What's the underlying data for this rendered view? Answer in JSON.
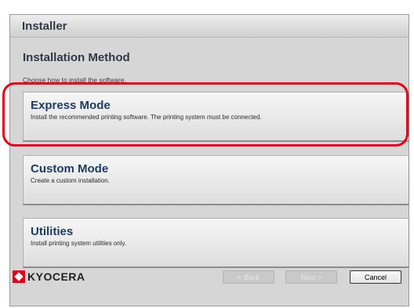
{
  "window": {
    "title": "Installer"
  },
  "page": {
    "heading": "Installation Method",
    "subtitle": "Choose how to install the software."
  },
  "options": [
    {
      "title": "Express Mode",
      "description": "Install the recommended printing software. The printing system must be connected."
    },
    {
      "title": "Custom Mode",
      "description": "Create a custom installation."
    },
    {
      "title": "Utilities",
      "description": "Install printing system utilities only."
    }
  ],
  "footer": {
    "logo_text": "KYOCERA",
    "back_label": "< Back",
    "next_label": "Next >",
    "cancel_label": "Cancel"
  },
  "colors": {
    "highlight": "#e0001a",
    "brand": "#e0001a",
    "option_title": "#1f3b63"
  },
  "icons": {
    "logo": "kyocera-logo-icon"
  }
}
